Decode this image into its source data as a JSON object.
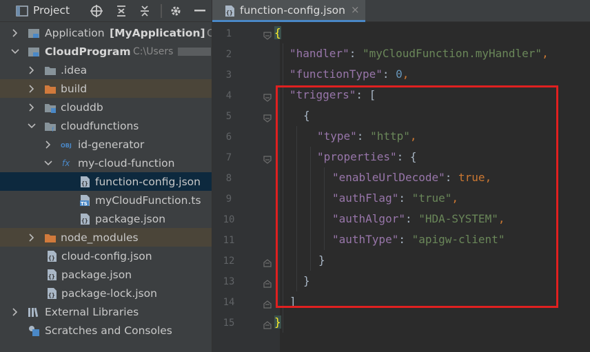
{
  "project_panel": {
    "title": "Project",
    "tree": [
      {
        "label": "Application",
        "suffix": "[MyApplication]",
        "extra": "C",
        "icon": "module-folder-icon"
      },
      {
        "label": "CloudProgram",
        "extra": "C:\\Users",
        "icon": "module-folder-icon"
      },
      {
        "label": ".idea",
        "icon": "folder-icon"
      },
      {
        "label": "build",
        "icon": "folder-orange-icon"
      },
      {
        "label": "clouddb",
        "icon": "clouddb-folder-icon"
      },
      {
        "label": "cloudfunctions",
        "icon": "cloudfunctions-folder-icon"
      },
      {
        "label": "id-generator",
        "icon": "obj-icon"
      },
      {
        "label": "my-cloud-function",
        "icon": "fx-icon"
      },
      {
        "label": "function-config.json",
        "icon": "json-file-icon"
      },
      {
        "label": "myCloudFunction.ts",
        "icon": "ts-file-icon"
      },
      {
        "label": "package.json",
        "icon": "json-file-icon"
      },
      {
        "label": "node_modules",
        "icon": "folder-orange-icon"
      },
      {
        "label": "cloud-config.json",
        "icon": "json-file-icon"
      },
      {
        "label": "package.json",
        "icon": "json-file-icon"
      },
      {
        "label": "package-lock.json",
        "icon": "json-file-icon"
      },
      {
        "label": "External Libraries",
        "icon": "libraries-icon"
      },
      {
        "label": "Scratches and Consoles",
        "icon": "scratches-icon"
      }
    ]
  },
  "editor": {
    "tab": {
      "title": "function-config.json",
      "close": "×"
    },
    "line_numbers": [
      "1",
      "2",
      "3",
      "4",
      "5",
      "6",
      "7",
      "8",
      "9",
      "10",
      "11",
      "12",
      "13",
      "14",
      "15"
    ],
    "code": {
      "l1": "{",
      "handler_key": "\"handler\"",
      "handler_val": "\"myCloudFunction.myHandler\"",
      "ftype_key": "\"functionType\"",
      "ftype_val": "0",
      "triggers_key": "\"triggers\"",
      "type_key": "\"type\"",
      "type_val": "\"http\"",
      "props_key": "\"properties\"",
      "eud_key": "\"enableUrlDecode\"",
      "eud_val": "true",
      "af_key": "\"authFlag\"",
      "af_val": "\"true\"",
      "aa_key": "\"authAlgor\"",
      "aa_val": "\"HDA-SYSTEM\"",
      "at_key": "\"authType\"",
      "at_val": "\"apigw-client\"",
      "colon": ": ",
      "comma": ",",
      "open_bracket": "[",
      "close_bracket": "]",
      "open_brace": "{",
      "close_brace": "}",
      "l15": "}"
    }
  },
  "colors": {
    "key": "#9876aa",
    "string": "#6a8759",
    "number": "#6897bb",
    "keyword": "#cc7832",
    "highlight_box": "#e02020"
  }
}
